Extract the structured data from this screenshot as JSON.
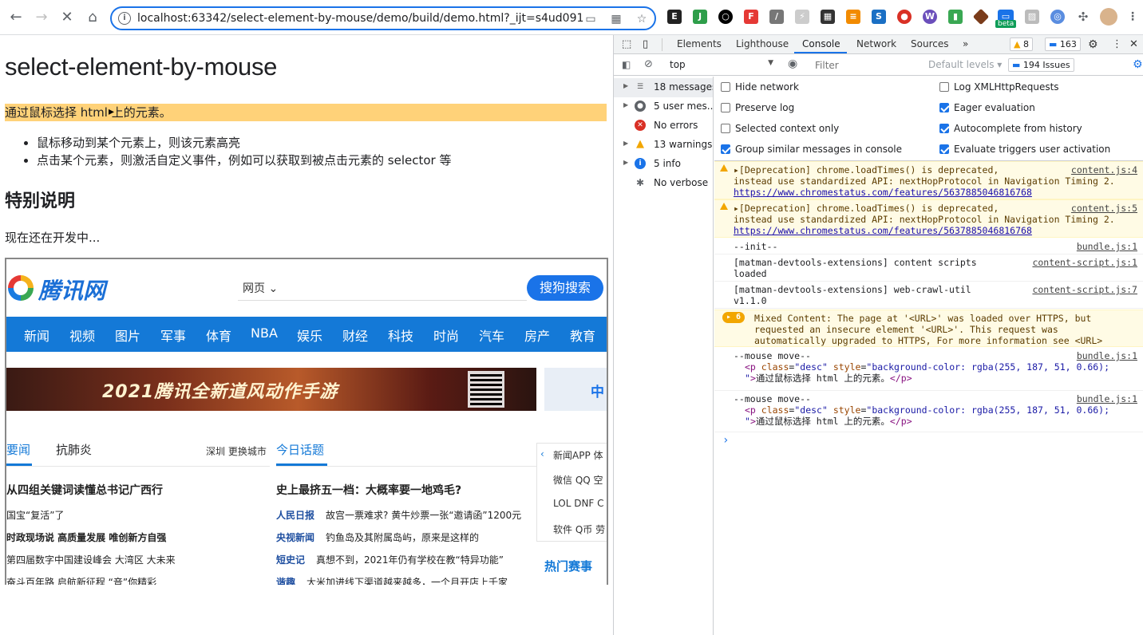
{
  "browser": {
    "url": "localhost:63342/select-element-by-mouse/demo/build/demo.html?_ijt=s4ud091...",
    "extensions": [
      "evernote-icon",
      "extension-icon",
      "circle-icon",
      "pdf-icon",
      "eyedropper-icon",
      "bolt-icon",
      "qr-icon",
      "doc-icon",
      "box-icon",
      "record-icon",
      "ws-icon",
      "evernote-green-icon",
      "diamond-icon",
      "beta-icon",
      "image-icon",
      "globe-icon",
      "puzzle-icon",
      "avatar"
    ],
    "beta_label": "beta"
  },
  "page": {
    "title": "select-element-by-mouse",
    "desc": "通过鼠标选择 html 上的元素。",
    "features": [
      "鼠标移动到某个元素上，则该元素高亮",
      "点击某个元素，则激活自定义事件，例如可以获取到被点击元素的 selector 等"
    ],
    "notice_heading": "特别说明",
    "notice_text": "现在还在开发中..."
  },
  "qq": {
    "logo_text": "腾讯网",
    "search_type": "网页",
    "search_button": "搜狗搜索",
    "nav": [
      "新闻",
      "视频",
      "图片",
      "军事",
      "体育",
      "NBA",
      "娱乐",
      "财经",
      "科技",
      "时尚",
      "汽车",
      "房产",
      "教育"
    ],
    "banner_text": "2021腾讯全新道风动作手游",
    "side_ad": "中",
    "tabs": [
      "要闻",
      "抗肺炎",
      "今日话题"
    ],
    "city": "深圳  更换城市",
    "left_news": [
      "从四组关键词读懂总书记广西行",
      "国宝“复活”了",
      "时政现场说 高质量发展 唯创新方自强",
      "第四届数字中国建设峰会 大湾区 大未来",
      "奋斗百年路 启航新征程 “音”你精彩"
    ],
    "mid_headline": "史上最挤五一档：大概率要一地鸡毛?",
    "mid_news": [
      {
        "src": "人民日报",
        "text": "故宫一票难求? 黄牛炒票一张“邀请函”1200元"
      },
      {
        "src": "央视新闻",
        "text": "钓鱼岛及其附属岛屿，原来是这样的"
      },
      {
        "src": "短史记",
        "text": "真想不到，2021年仍有学校在教“特异功能”"
      },
      {
        "src": "谐趣",
        "text": "大米加进线下渠道越来越多，一个月开店上千家"
      }
    ],
    "right_rows": [
      "新闻APP  体",
      "微信  QQ  空",
      "LOL  DNF  C",
      "软件  Q币  劳"
    ],
    "hot": "热门赛事"
  },
  "devtools": {
    "tabs": [
      "Elements",
      "Lighthouse",
      "Console",
      "Network",
      "Sources"
    ],
    "more": "»",
    "warn_count": "8",
    "msg_count": "163",
    "context": "top",
    "filter_placeholder": "Filter",
    "levels": "Default levels ▾",
    "issues": "194 Issues",
    "sidebar": [
      {
        "label": "18 messages",
        "icon": "list-icon"
      },
      {
        "label": "5 user mes...",
        "icon": "user-icon"
      },
      {
        "label": "No errors",
        "icon": "error-icon"
      },
      {
        "label": "13 warnings",
        "icon": "warning-icon"
      },
      {
        "label": "5 info",
        "icon": "info-icon"
      },
      {
        "label": "No verbose",
        "icon": "bug-icon"
      }
    ],
    "settings_left": [
      {
        "label": "Hide network",
        "checked": false
      },
      {
        "label": "Preserve log",
        "checked": false
      },
      {
        "label": "Selected context only",
        "checked": false
      },
      {
        "label": "Group similar messages in console",
        "checked": true
      }
    ],
    "settings_right": [
      {
        "label": "Log XMLHttpRequests",
        "checked": false
      },
      {
        "label": "Eager evaluation",
        "checked": true
      },
      {
        "label": "Autocomplete from history",
        "checked": true
      },
      {
        "label": "Evaluate triggers user activation",
        "checked": true
      }
    ],
    "console": {
      "warn1_l1": "▸[Deprecation] chrome.loadTimes() is deprecated,",
      "warn1_l2": "instead use standardized API: nextHopProtocol in Navigation Timing 2.",
      "warn1_link": "https://www.chromestatus.com/features/5637885046816768",
      "warn1_src": "content.js:4",
      "warn2_src": "content.js:5",
      "init": "--init--",
      "init_src": "bundle.js:1",
      "ext1_l1": "[matman-devtools-extensions] content scripts",
      "ext1_l2": "loaded",
      "ext1_src": "content-script.js:1",
      "ext2_l1": "[matman-devtools-extensions] web-crawl-util",
      "ext2_l2": "v1.1.0",
      "ext2_src": "content-script.js:7",
      "mixed_count": "6",
      "mixed_l1": "Mixed Content: The page at '<URL>' was loaded over HTTPS, but",
      "mixed_l2": "requested an insecure element '<URL>'. This request was",
      "mixed_l3": "automatically upgraded to HTTPS, For more information see <URL>",
      "move": "--mouse move--",
      "move_src": "bundle.js:1",
      "p_text": "通过鼠标选择 html 上的元素。",
      "prompt": "›"
    }
  },
  "colors": {
    "highlight": "#ffbb33",
    "qq_blue": "#1479d7",
    "accent": "#1a73e8"
  }
}
